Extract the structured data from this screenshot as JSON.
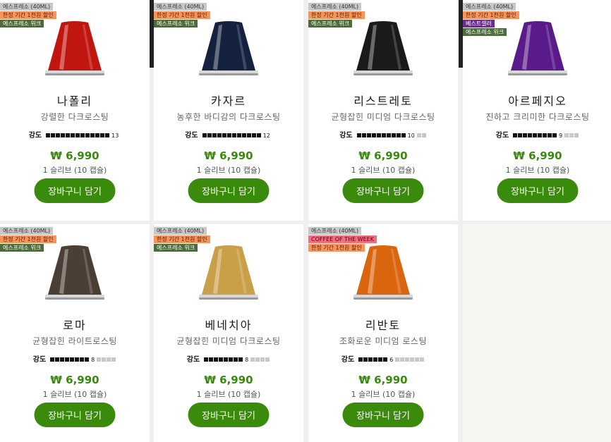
{
  "products": [
    {
      "badges": [
        {
          "text": "에스프레소 (40ML)",
          "style": "gray"
        },
        {
          "text": "한정 기간 1천원 할인",
          "style": "orange"
        },
        {
          "text": "에스프레소 위크",
          "style": "green"
        }
      ],
      "name": "나폴리",
      "description": "강렬한 다크로스팅",
      "intensity_label": "강도",
      "intensity": 13,
      "intensity_max": 13,
      "price": "₩ 6,990",
      "sleeve": "1 슬리브 (10 캡슐)",
      "cart_label": "장바구니 담기",
      "capsule_color": "#c1150f"
    },
    {
      "badges": [
        {
          "text": "에스프레소 (40ML)",
          "style": "gray"
        },
        {
          "text": "한정 기간 1천원 할인",
          "style": "orange"
        },
        {
          "text": "에스프레소 위크",
          "style": "green"
        }
      ],
      "name": "카자르",
      "description": "농후한 바디감의 다크로스팅",
      "intensity_label": "강도",
      "intensity": 12,
      "intensity_max": 12,
      "price": "₩ 6,990",
      "sleeve": "1 슬리브 (10 캡슐)",
      "cart_label": "장바구니 담기",
      "capsule_color": "#14213f"
    },
    {
      "badges": [
        {
          "text": "에스프레소 (40ML)",
          "style": "gray"
        },
        {
          "text": "한정 기간 1천원 할인",
          "style": "orange"
        },
        {
          "text": "에스프레소 위크",
          "style": "green"
        }
      ],
      "name": "리스트레토",
      "description": "균형잡힌 미디엄 다크로스팅",
      "intensity_label": "강도",
      "intensity": 10,
      "intensity_max": 12,
      "price": "₩ 6,990",
      "sleeve": "1 슬리브 (10 캡슐)",
      "cart_label": "장바구니 담기",
      "capsule_color": "#1a1a1a"
    },
    {
      "badges": [
        {
          "text": "에스프레소 (40ML)",
          "style": "gray"
        },
        {
          "text": "한정 기간 1천원 할인",
          "style": "orange"
        },
        {
          "text": "베스트셀러",
          "style": "purple"
        },
        {
          "text": "에스프레소 위크",
          "style": "green"
        }
      ],
      "name": "아르페지오",
      "description": "진하고 크리미한 다크로스팅",
      "intensity_label": "강도",
      "intensity": 9,
      "intensity_max": 12,
      "price": "₩ 6,990",
      "sleeve": "1 슬리브 (10 캡슐)",
      "cart_label": "장바구니 담기",
      "capsule_color": "#5a1a8a"
    },
    {
      "badges": [
        {
          "text": "에스프레소 (40ML)",
          "style": "gray"
        },
        {
          "text": "한정 기간 1천원 할인",
          "style": "orange"
        },
        {
          "text": "에스프레소 위크",
          "style": "green"
        }
      ],
      "name": "로마",
      "description": "균형잡힌 라이트로스팅",
      "intensity_label": "강도",
      "intensity": 8,
      "intensity_max": 12,
      "price": "₩ 6,990",
      "sleeve": "1 슬리브 (10 캡슐)",
      "cart_label": "장바구니 담기",
      "capsule_color": "#4a3e35"
    },
    {
      "badges": [
        {
          "text": "에스프레소 (40ML)",
          "style": "gray"
        },
        {
          "text": "한정 기간 1천원 할인",
          "style": "orange"
        },
        {
          "text": "에스프레소 위크",
          "style": "green"
        }
      ],
      "name": "베네치아",
      "description": "균형잡힌 미디엄 다크로스팅",
      "intensity_label": "강도",
      "intensity": 8,
      "intensity_max": 12,
      "price": "₩ 6,990",
      "sleeve": "1 슬리브 (10 캡슐)",
      "cart_label": "장바구니 담기",
      "capsule_color": "#c9a048"
    },
    {
      "badges": [
        {
          "text": "에스프레소 (40ML)",
          "style": "gray"
        },
        {
          "text": "COFFEE OF THE WEEK",
          "style": "pink"
        },
        {
          "text": "한정 기간 1천원 할인",
          "style": "orange"
        }
      ],
      "name": "리반토",
      "description": "조화로운 미디엄 로스팅",
      "intensity_label": "강도",
      "intensity": 6,
      "intensity_max": 12,
      "price": "₩ 6,990",
      "sleeve": "1 슬리브 (10 캡슐)",
      "cart_label": "장바구니 담기",
      "capsule_color": "#d9650e"
    }
  ]
}
